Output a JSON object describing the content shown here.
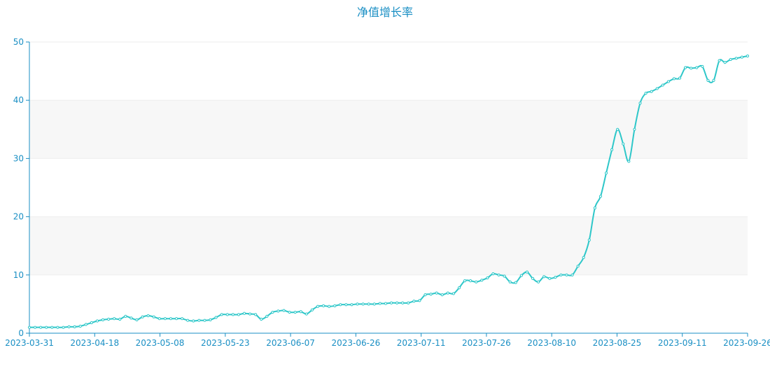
{
  "chart_data": {
    "type": "line",
    "title": "净值增长率",
    "xlabel": "",
    "ylabel": "",
    "ylim": [
      0,
      50
    ],
    "yticks": [
      0,
      10,
      20,
      30,
      40,
      50
    ],
    "x_tick_labels": [
      "2023-03-31",
      "2023-04-18",
      "2023-05-08",
      "2023-05-23",
      "2023-06-07",
      "2023-06-26",
      "2023-07-11",
      "2023-07-26",
      "2023-08-10",
      "2023-08-25",
      "2023-09-11",
      "2023-09-26"
    ],
    "grid": "horizontal bands",
    "legend": "none",
    "colors": {
      "line": "#2ec7c9",
      "axis": "#1a8fc4",
      "band": "#f7f7f7",
      "grid": "#eeeeee"
    },
    "series": [
      {
        "values": [
          1.0,
          1.0,
          1.0,
          1.0,
          1.0,
          1.0,
          1.0,
          1.1,
          1.1,
          1.2,
          1.5,
          1.8,
          2.1,
          2.3,
          2.4,
          2.5,
          2.4,
          2.9,
          2.6,
          2.3,
          2.8,
          3.0,
          2.8,
          2.5,
          2.5,
          2.5,
          2.5,
          2.5,
          2.2,
          2.1,
          2.2,
          2.2,
          2.3,
          2.7,
          3.2,
          3.2,
          3.2,
          3.2,
          3.4,
          3.3,
          3.2,
          2.4,
          2.9,
          3.6,
          3.8,
          3.9,
          3.6,
          3.6,
          3.7,
          3.3,
          4.0,
          4.6,
          4.7,
          4.6,
          4.7,
          4.9,
          4.9,
          4.9,
          5.0,
          5.0,
          5.0,
          5.0,
          5.1,
          5.1,
          5.2,
          5.2,
          5.2,
          5.2,
          5.5,
          5.6,
          6.6,
          6.7,
          6.9,
          6.6,
          6.9,
          6.8,
          7.8,
          9.0,
          9.0,
          8.8,
          9.1,
          9.5,
          10.2,
          10.0,
          9.8,
          8.8,
          8.7,
          9.9,
          10.5,
          9.4,
          8.8,
          9.7,
          9.4,
          9.6,
          10.0,
          10.0,
          10.0,
          11.5,
          13.0,
          16.0,
          21.5,
          23.5,
          27.5,
          31.5,
          35.0,
          32.5,
          29.5,
          35.0,
          39.5,
          41.2,
          41.5,
          42.0,
          42.6,
          43.2,
          43.7,
          43.8,
          45.6,
          45.5,
          45.6,
          45.8,
          43.4,
          43.4,
          46.8,
          46.5,
          47.0,
          47.2,
          47.4,
          47.6
        ]
      }
    ]
  }
}
